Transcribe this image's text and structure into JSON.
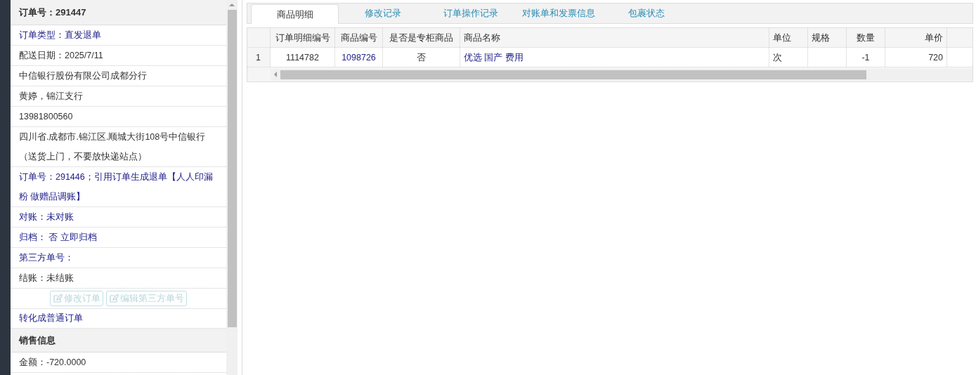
{
  "order_panel": {
    "title": "订单号：291447",
    "rows": [
      {
        "kind": "link",
        "text": "订单类型：直发退单"
      },
      {
        "kind": "text",
        "text": "配送日期：2025/7/11"
      },
      {
        "kind": "text",
        "text": "中信银行股份有限公司成都分行"
      },
      {
        "kind": "text",
        "text": "黄婷，锦江支行"
      },
      {
        "kind": "text",
        "text": "13981800560"
      },
      {
        "kind": "text",
        "text": "四川省.成都市.锦江区.顺城大街108号中信银行（送货上门，不要放快递站点）"
      },
      {
        "kind": "link",
        "text": "订单号：291446；引用订单生成退单【人人印漏粉 做赠品调账】"
      },
      {
        "kind": "link",
        "text": "对账：未对账"
      },
      {
        "kind": "link",
        "text": "归档： 否 立即归档"
      },
      {
        "kind": "link",
        "text": "第三方单号："
      },
      {
        "kind": "text",
        "text": "结账：未结账"
      }
    ],
    "buttons": [
      {
        "label": "修改订单",
        "disabled": true
      },
      {
        "label": "编辑第三方单号",
        "disabled": true
      }
    ],
    "convert_link": "转化成普通订单"
  },
  "sales_panel": {
    "title": "销售信息",
    "rows": [
      {
        "kind": "text",
        "text": "金额：-720.0000"
      }
    ]
  },
  "tabs": [
    {
      "label": "商品明细",
      "selected": true
    },
    {
      "label": "修改记录",
      "selected": false
    },
    {
      "label": "订单操作记录",
      "selected": false
    },
    {
      "label": "对账单和发票信息",
      "selected": false
    },
    {
      "label": "包裹状态",
      "selected": false
    }
  ],
  "table": {
    "columns": [
      "订单明细编号",
      "商品编号",
      "是否是专柜商品",
      "商品名称",
      "单位",
      "规格",
      "数量",
      "单价"
    ],
    "rows": [
      {
        "index": "1",
        "cells": [
          "1114782",
          "1098726",
          "否",
          "优选 国产 费用",
          "次",
          "",
          "-1",
          "720"
        ]
      }
    ]
  }
}
